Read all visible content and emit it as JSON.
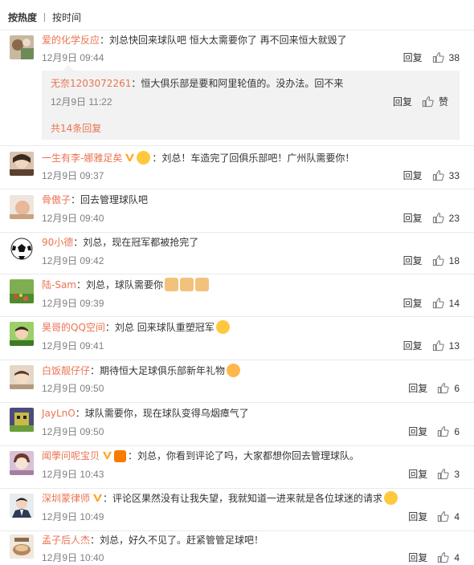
{
  "sort": {
    "hot": "按热度",
    "time": "按时间"
  },
  "labels": {
    "reply": "回复",
    "like": "赞"
  },
  "comments": [
    {
      "user": "爱的化学反应",
      "text": "：刘总快回来球队吧 恒大太需要你了 再不回来恒大就毁了",
      "time": "12月9日 09:44",
      "likes": "38"
    },
    {
      "user": "一生有李-娜雅足矣",
      "text": "：刘总！车造完了回俱乐部吧！广州队需要你！",
      "time": "12月9日 09:37",
      "likes": "33"
    },
    {
      "user": "骨傲子",
      "text": "：回去管理球队吧",
      "time": "12月9日 09:40",
      "likes": "23"
    },
    {
      "user": "90小德",
      "text": "：刘总，现在冠军都被抢完了",
      "time": "12月9日 09:42",
      "likes": "18"
    },
    {
      "user": "陆-Sam",
      "text": "：刘总，球队需要你",
      "time": "12月9日 09:39",
      "likes": "14"
    },
    {
      "user": "昊哥的QQ空间",
      "text": "：刘总 回来球队重塑冠军",
      "time": "12月9日 09:41",
      "likes": "13"
    },
    {
      "user": "白饭靓仔仔",
      "text": "：期待恒大足球俱乐部新年礼物",
      "time": "12月9日 09:50",
      "likes": "6"
    },
    {
      "user": "JayLnO",
      "text": "：球队需要你，现在球队变得乌烟瘴气了",
      "time": "12月9日 09:50",
      "likes": "6"
    },
    {
      "user": "闻荸问呢宝贝",
      "text": "：刘总，你看到评论了吗，大家都想你回去管理球队。",
      "time": "12月9日 10:43",
      "likes": "3"
    },
    {
      "user": "深圳蒙律师",
      "text": "：评论区果然没有让我失望，我就知道一进来就是各位球迷的请求",
      "time": "12月9日 10:49",
      "likes": "4"
    },
    {
      "user": "孟子后人杰",
      "text": "：刘总，好久不见了。赶紧管管足球吧！",
      "time": "12月9日 10:40",
      "likes": "4"
    }
  ],
  "reply_box": {
    "user": "无奈1203072261",
    "text": "：恒大俱乐部是要和阿里轮值的。没办法。回不来",
    "time": "12月9日 11:22",
    "total": "共14条回复"
  },
  "colors": {
    "username": "#eb7350",
    "text": "#333333",
    "time": "#808080",
    "vip": "#ffa726"
  }
}
